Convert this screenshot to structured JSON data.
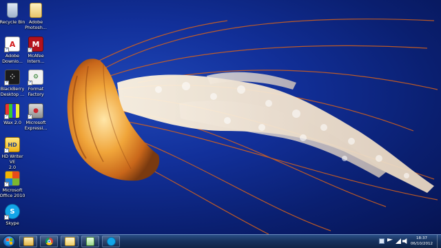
{
  "desktop_icons": [
    {
      "label": "Recycle Bin",
      "icon": "recycle-bin-icon"
    },
    {
      "label": "Adobe\nPhotosh...",
      "icon": "adobe-photoshop-folder-icon"
    },
    {
      "label": "Adobe\nDownlo...",
      "icon": "adobe-download-icon"
    },
    {
      "label": "McAfee\nIntern...",
      "icon": "mcafee-icon"
    },
    {
      "label": "BlackBerry\nDesktop ...",
      "icon": "blackberry-icon"
    },
    {
      "label": "Format\nFactory",
      "icon": "format-factory-icon"
    },
    {
      "label": "Wax 2.0",
      "icon": "wax-icon"
    },
    {
      "label": "Microsoft\nExpressi...",
      "icon": "microsoft-expression-icon"
    },
    {
      "label": "HD Writer VE\n2.0",
      "icon": "hd-writer-icon"
    },
    {
      "label": "Microsoft\nOffice 2010",
      "icon": "microsoft-office-icon"
    },
    {
      "label": "Skype",
      "icon": "skype-icon"
    }
  ],
  "taskbar": {
    "pinned": [
      {
        "name": "windows-explorer-icon"
      },
      {
        "name": "chrome-icon"
      },
      {
        "name": "folder-icon"
      },
      {
        "name": "file-icon"
      },
      {
        "name": "skype-icon"
      }
    ],
    "clock": {
      "time": "18:37",
      "date": "06/10/2012"
    }
  },
  "colors": {
    "background": "#0a1f70",
    "jellyfish": "#e88a22",
    "taskbar": "#17325e"
  }
}
